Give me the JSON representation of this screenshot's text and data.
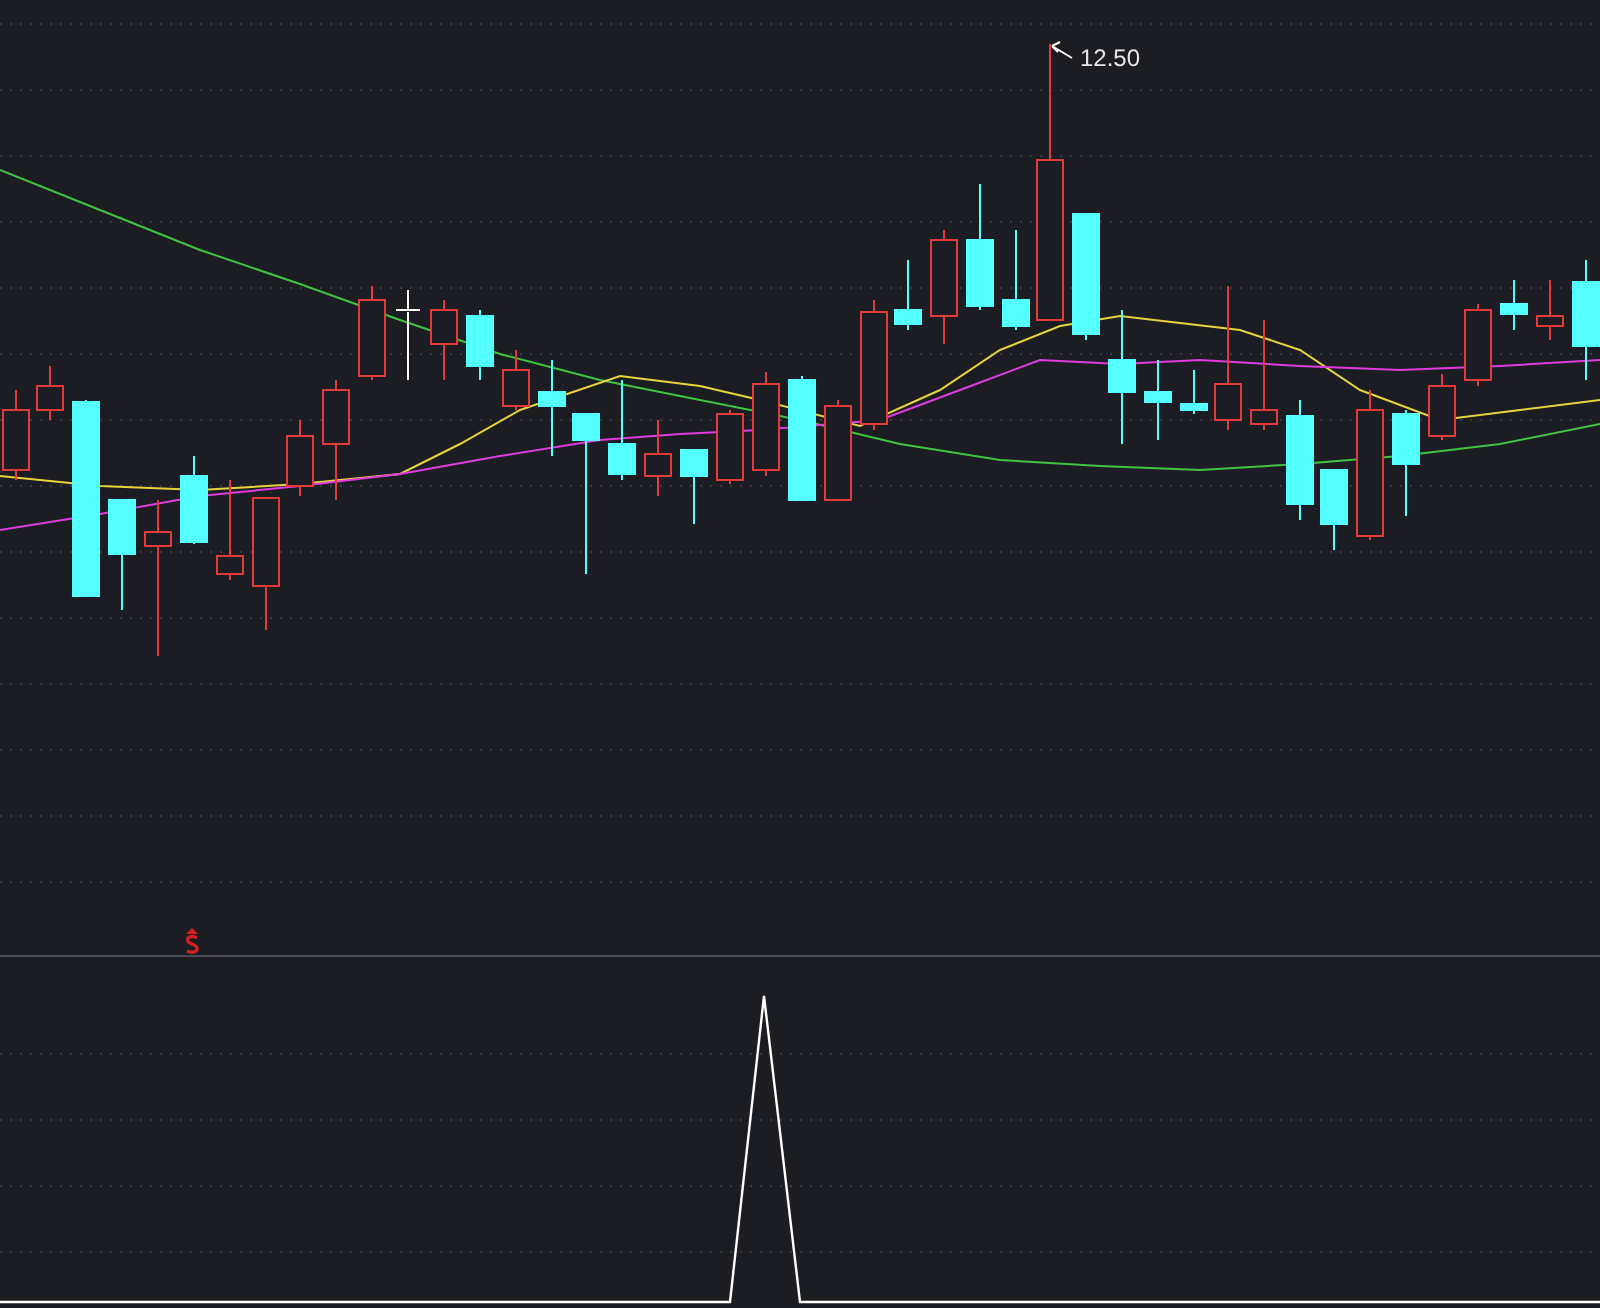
{
  "main_panel": {
    "high_price_label": "12.50"
  }
}
